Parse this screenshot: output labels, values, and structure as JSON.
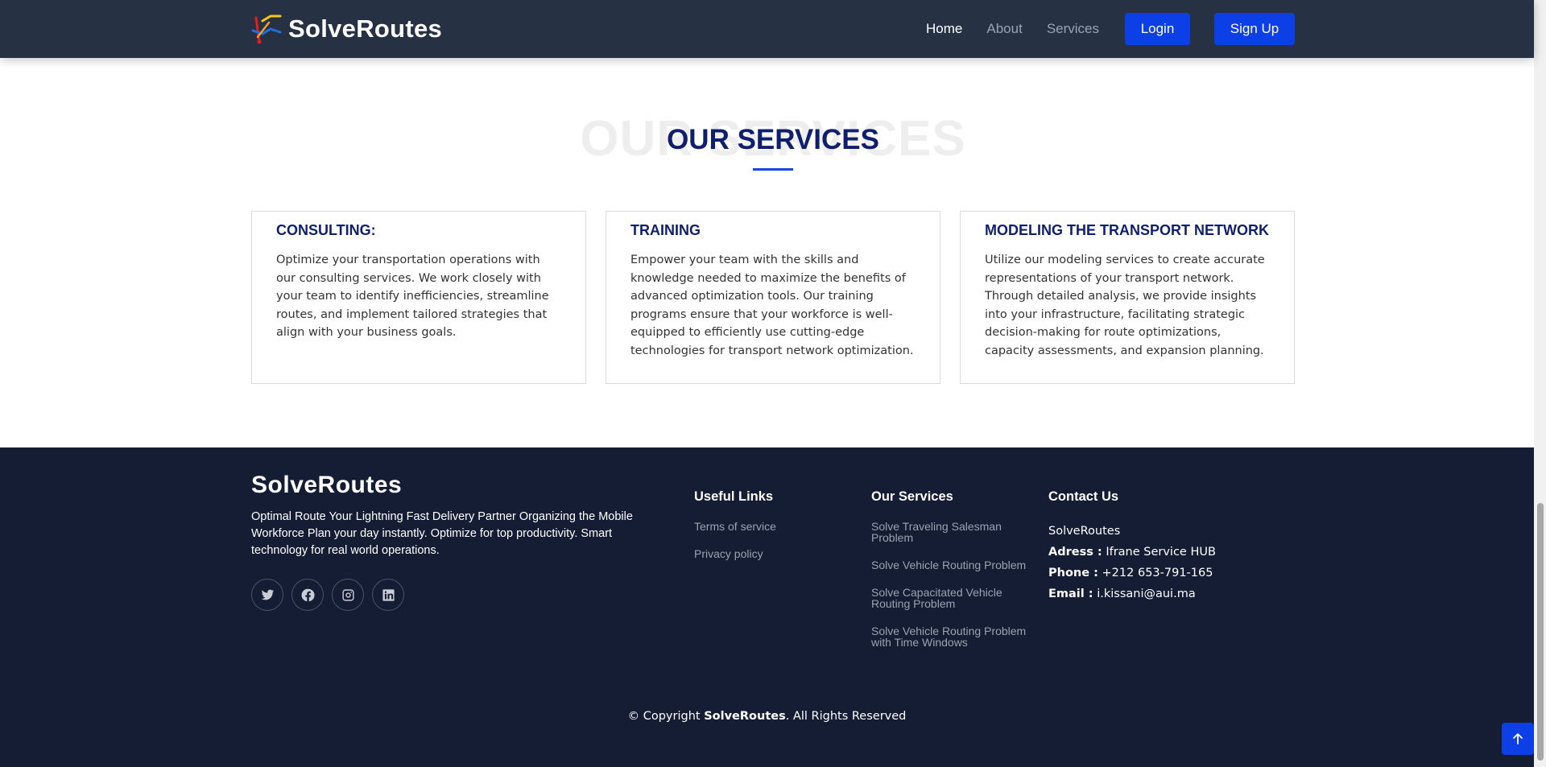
{
  "header": {
    "brand": "SolveRoutes",
    "nav": {
      "home": "Home",
      "about": "About",
      "services": "Services"
    },
    "login": "Login",
    "signup": "Sign Up"
  },
  "services": {
    "title_bg": "OUR SERVICES",
    "title": "OUR SERVICES",
    "cards": [
      {
        "title": "CONSULTING:",
        "text": "Optimize your transportation operations with our consulting services. We work closely with your team to identify inefficiencies, streamline routes, and implement tailored strategies that align with your business goals."
      },
      {
        "title": "TRAINING",
        "text": "Empower your team with the skills and knowledge needed to maximize the benefits of advanced optimization tools. Our training programs ensure that your workforce is well-equipped to efficiently use cutting-edge technologies for transport network optimization."
      },
      {
        "title": "MODELING THE TRANSPORT NETWORK",
        "text": "Utilize our modeling services to create accurate representations of your transport network. Through detailed analysis, we provide insights into your infrastructure, facilitating strategic decision-making for route optimizations, capacity assessments, and expansion planning."
      }
    ]
  },
  "footer": {
    "brand": "SolveRoutes",
    "description": "Optimal Route Your Lightning Fast Delivery Partner Organizing the Mobile Workforce Plan your day instantly. Optimize for top productivity. Smart technology for real world operations.",
    "socials": [
      "twitter-icon",
      "facebook-icon",
      "instagram-icon",
      "linkedin-icon"
    ],
    "useful_links": {
      "title": "Useful Links",
      "items": [
        "Terms of service",
        "Privacy policy"
      ]
    },
    "our_services": {
      "title": "Our Services",
      "items": [
        "Solve Traveling Salesman Problem",
        "Solve Vehicle Routing Problem",
        "Solve Capacitated Vehicle Routing Problem",
        "Solve Vehicle Routing Problem with Time Windows"
      ]
    },
    "contact": {
      "title": "Contact Us",
      "name": "SolveRoutes",
      "address_label": "Adress :",
      "address": "Ifrane Service HUB",
      "phone_label": "Phone :",
      "phone": "+212 653-791-165",
      "email_label": "Email :",
      "email": "i.kissani@aui.ma"
    },
    "copyright_prefix": "© Copyright",
    "copyright_brand": "SolveRoutes",
    "copyright_suffix": ". All Rights Reserved"
  },
  "colors": {
    "header_bg": "#263244",
    "footer_bg": "#141d33",
    "accent": "#0d3fe6",
    "title": "#0f1f6e"
  }
}
